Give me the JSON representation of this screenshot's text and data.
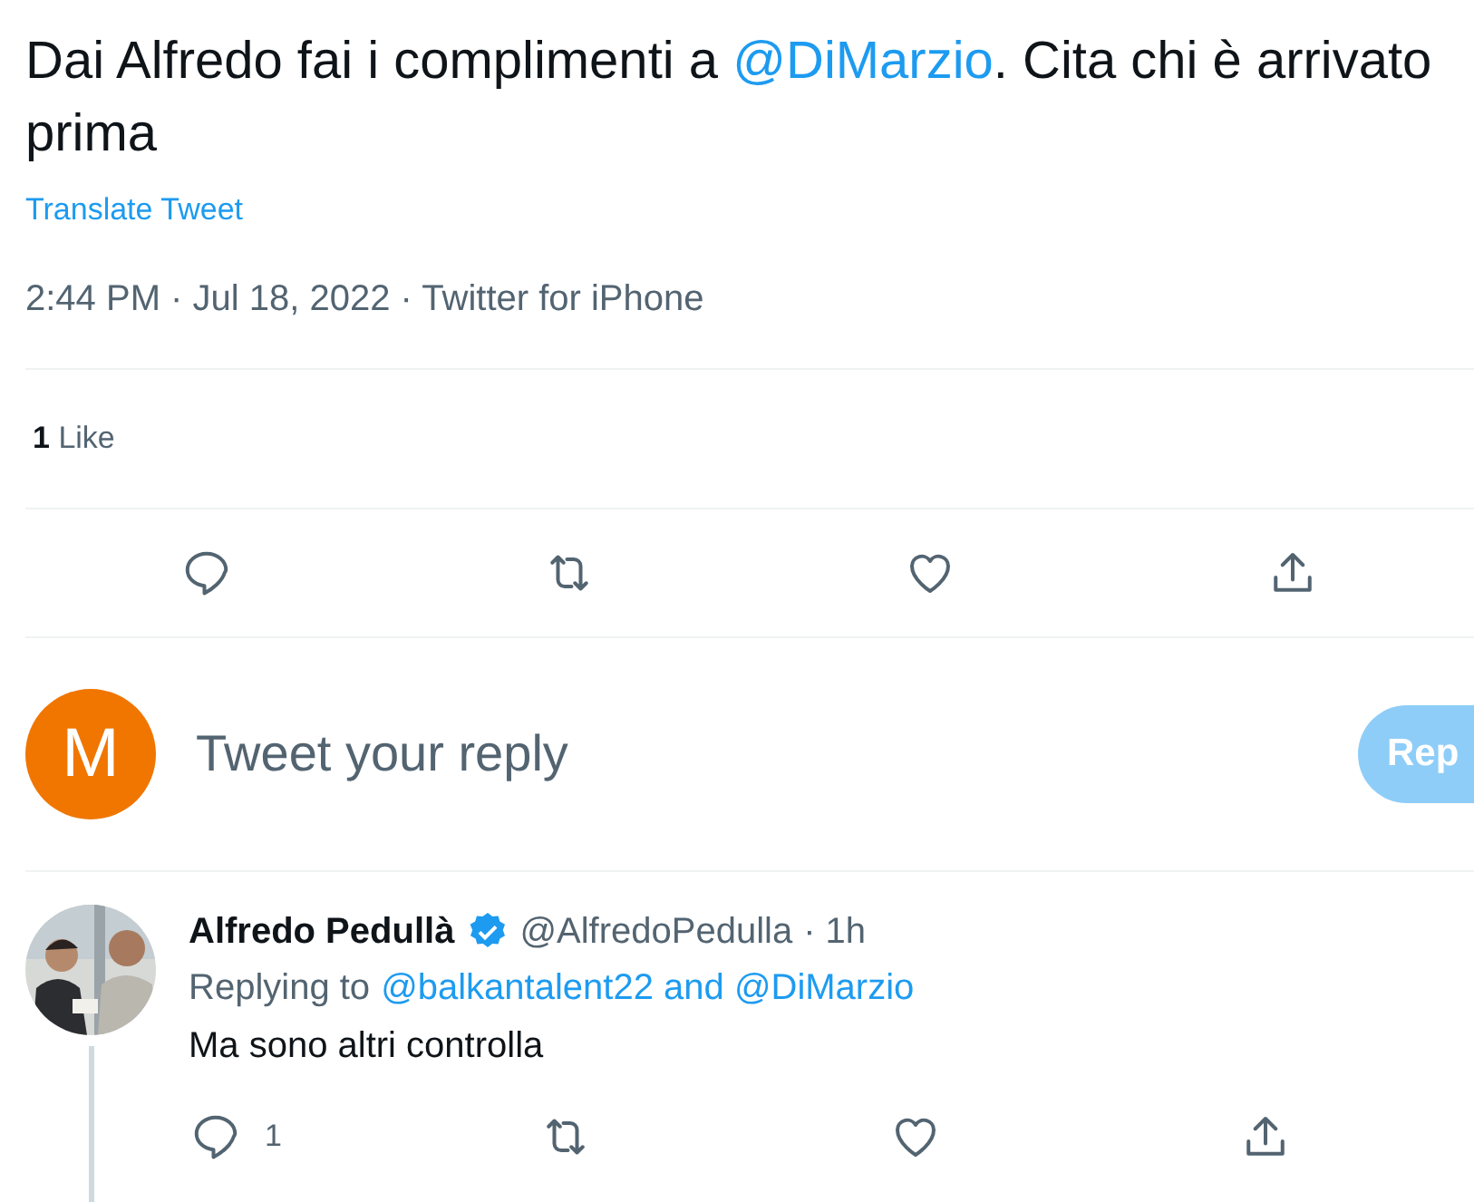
{
  "tweet": {
    "text": [
      {
        "kind": "plain",
        "text": "Dai Alfredo fai i complimenti a "
      },
      {
        "kind": "mention",
        "text": "@DiMarzio"
      },
      {
        "kind": "plain",
        "text": ". Cita chi è arrivato prima"
      }
    ],
    "translate": "Translate Tweet",
    "meta": "2:44 PM · Jul 18, 2022 · Twitter for iPhone",
    "likes": {
      "count": "1",
      "label": "Like"
    },
    "actions": [
      {
        "kind": "reply"
      },
      {
        "kind": "retweet"
      },
      {
        "kind": "like"
      },
      {
        "kind": "share"
      }
    ]
  },
  "composer": {
    "avatar_letter": "M",
    "placeholder": "Tweet your reply",
    "button": "Rep",
    "disabled": true
  },
  "reply": {
    "name": "Alfredo Pedullà",
    "verified": true,
    "handle": "@AlfredoPedulla",
    "time": "· 1h",
    "replying_label": "Replying to",
    "replying_to": "@balkantalent22 and @DiMarzio",
    "text": "Ma sono altri controlla",
    "actions": [
      {
        "kind": "reply",
        "count": "1"
      },
      {
        "kind": "retweet"
      },
      {
        "kind": "like"
      },
      {
        "kind": "share"
      }
    ]
  }
}
